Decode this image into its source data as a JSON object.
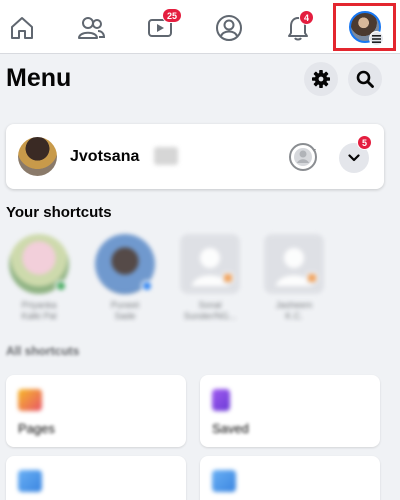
{
  "nav": {
    "watch_badge": "25",
    "notifications_badge": "4",
    "highlight_color": "#e3262f"
  },
  "header": {
    "title": "Menu"
  },
  "profile_card": {
    "name": "Jvotsana",
    "menu_badge": "5"
  },
  "shortcuts": {
    "title": "Your shortcuts",
    "items": [
      {
        "label_line1": "Priyanka",
        "label_line2": "Kalki Pal"
      },
      {
        "label_line1": "Puneet",
        "label_line2": "Sade"
      },
      {
        "label_line1": "Sonal",
        "label_line2": "Sunder/NG..."
      },
      {
        "label_line1": "Jasheem",
        "label_line2": "K.C."
      }
    ]
  },
  "all_shortcuts": {
    "title": "All shortcuts",
    "tiles": [
      {
        "label": "Pages"
      },
      {
        "label": "Saved"
      }
    ]
  },
  "colors": {
    "brand_blue": "#1877f2",
    "badge_red": "#e41e3f"
  }
}
